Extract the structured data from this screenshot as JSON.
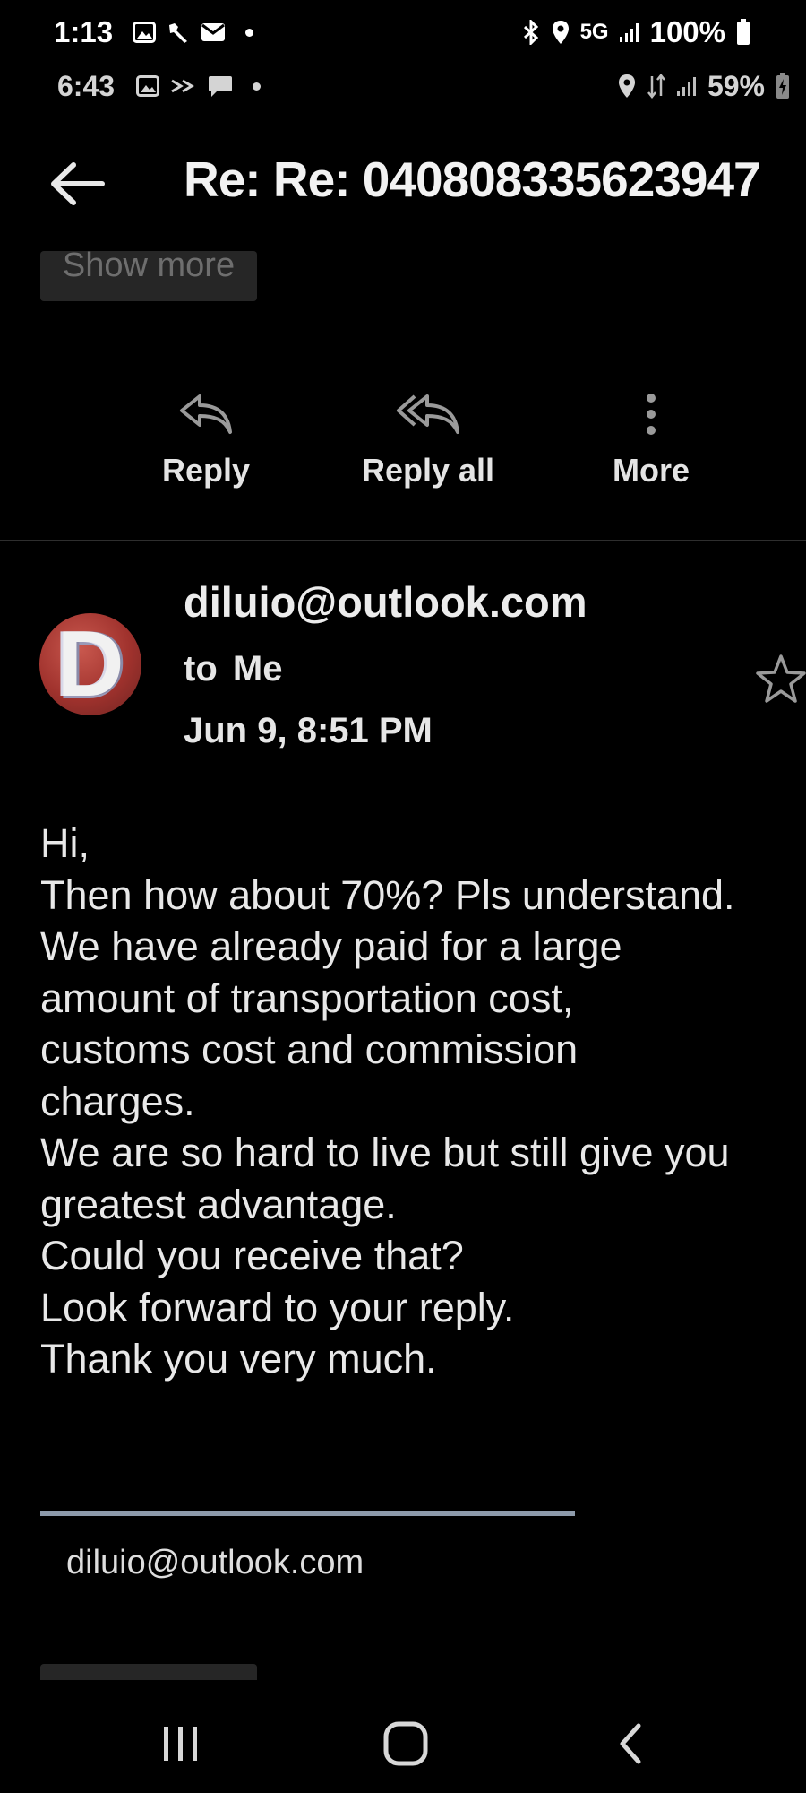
{
  "status_bar_outer": {
    "time": "1:13",
    "left_icons": [
      "gallery-icon",
      "tools-icon",
      "mail-icon",
      "dot-icon"
    ],
    "right_icons": [
      "bluetooth-icon",
      "location-icon"
    ],
    "network": "5G",
    "battery": "100%"
  },
  "status_bar_inner": {
    "time": "6:43",
    "left_icons": [
      "gallery-icon",
      "forward-icon",
      "chat-icon",
      "dot-icon"
    ],
    "right_icons": [
      "location-icon",
      "signal-icon"
    ],
    "battery": "59%"
  },
  "header": {
    "subject": "Re: Re: 040808335623947"
  },
  "show_more_label": "Show more",
  "actions": {
    "reply_label": "Reply",
    "reply_all_label": "Reply all",
    "more_label": "More"
  },
  "message": {
    "avatar_letter": "D",
    "sender": "diluio@outlook.com",
    "to_line": "to Me",
    "date": "Jun 9, 8:51 PM",
    "body_lines": [
      "Hi,",
      "Then how about 70%? Pls understand.",
      "We have already paid for a large",
      "amount of transportation cost,",
      "customs cost and commission",
      "charges.",
      "We are so hard to live but still give you",
      "greatest advantage.",
      "Could you receive that?",
      "Look forward to your reply.",
      "Thank you very much."
    ],
    "signature_email": "diluio@outlook.com"
  },
  "colors": {
    "background": "#000000",
    "text": "#e6e6e6",
    "button_bg": "#262626",
    "signature_rule": "#8e9bab",
    "avatar": "#a0322d"
  }
}
